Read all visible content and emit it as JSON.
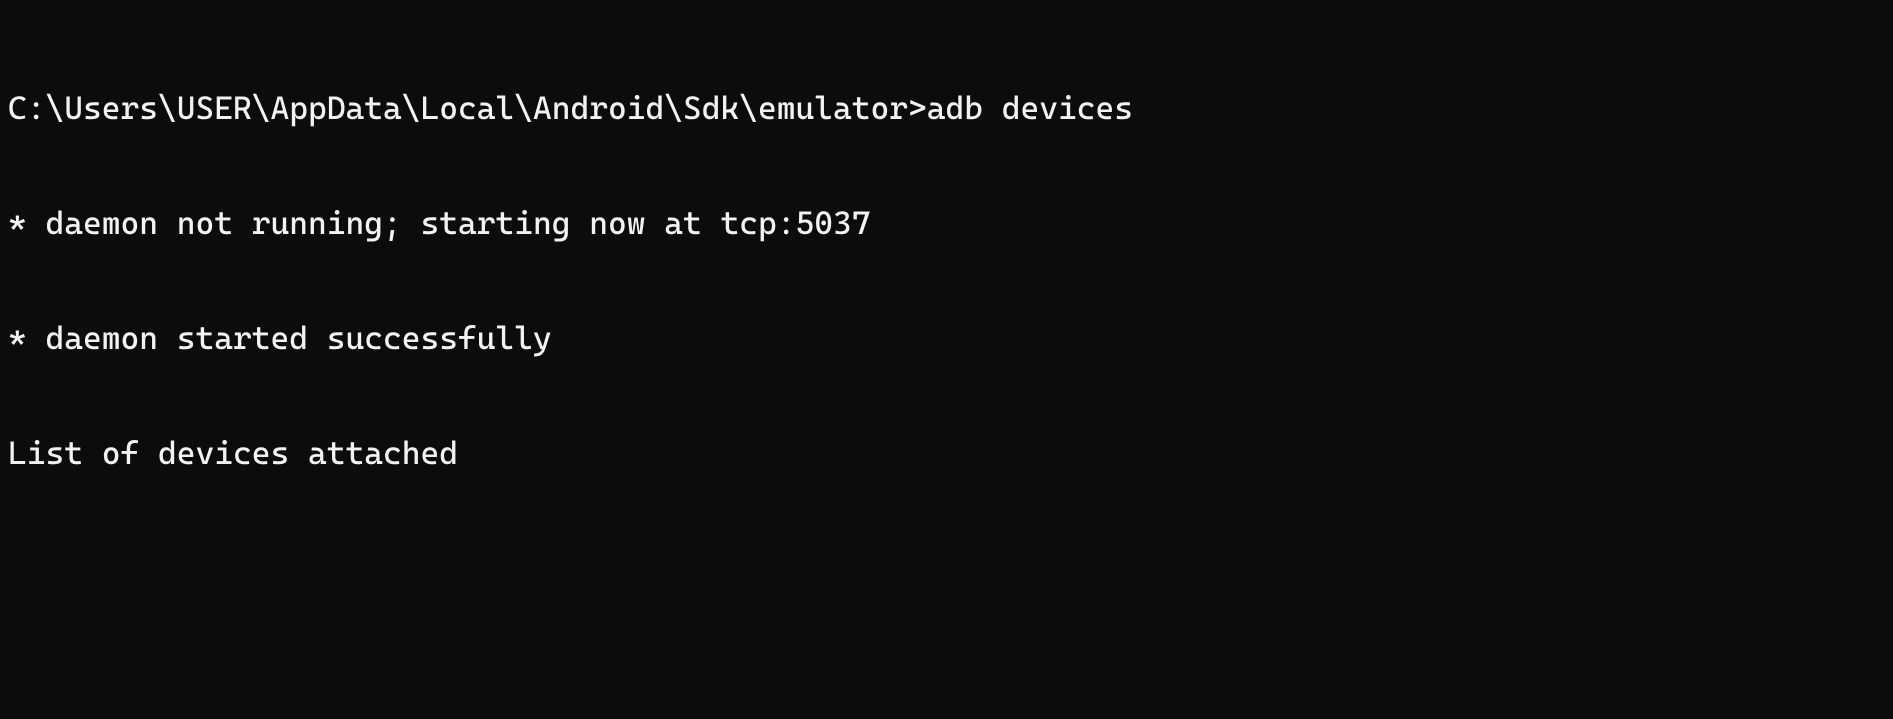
{
  "terminal": {
    "prompt": "C:\\Users\\USER\\AppData\\Local\\Android\\Sdk\\emulator>",
    "command": "adb devices",
    "output": [
      "* daemon not running; starting now at tcp:5037",
      "* daemon started successfully",
      "List of devices attached"
    ]
  }
}
